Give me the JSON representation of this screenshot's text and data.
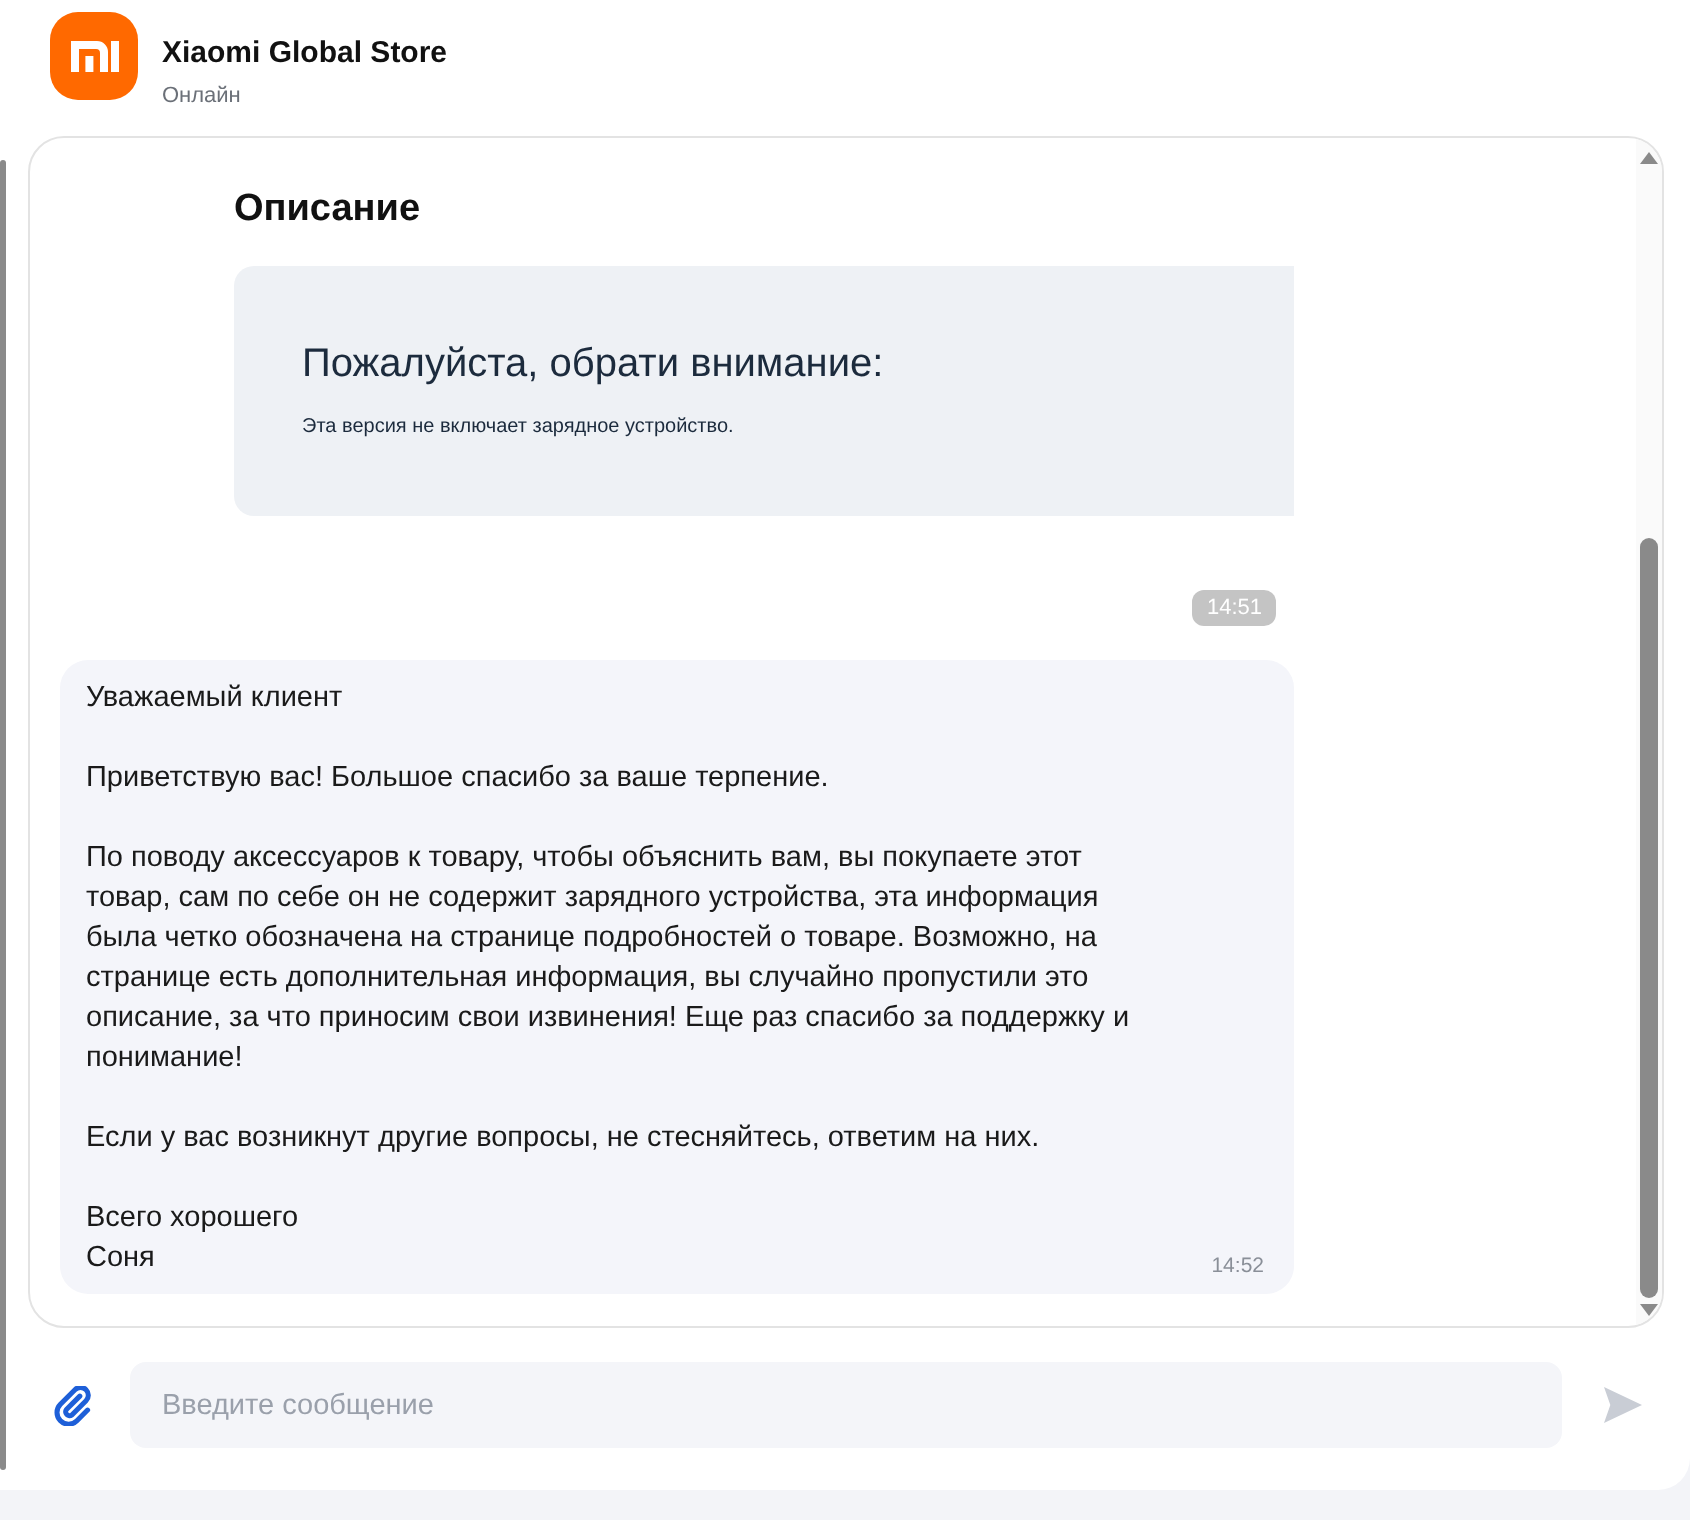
{
  "header": {
    "store_name": "Xiaomi Global Store",
    "status": "Онлайн"
  },
  "messages": [
    {
      "kind": "card",
      "heading": "Описание",
      "notice_title": "Пожалуйста, обрати внимание:",
      "notice_text": "Эта версия не включает зарядное устройство.",
      "time": "14:51"
    },
    {
      "kind": "text",
      "paragraphs": [
        "Уважаемый клиент",
        "Приветствую вас! Большое спасибо за ваше терпение.",
        "По поводу аксессуаров к товару, чтобы объяснить вам, вы покупаете этот товар, сам по себе он не содержит зарядного устройства, эта информация была четко обозначена на странице подробностей о товаре. Возможно, на странице есть дополнительная информация, вы случайно пропустили это описание, за что приносим свои извинения! Еще раз спасибо за поддержку и понимание!",
        "Если у вас возникнут другие вопросы, не стесняйтесь, ответим на них.",
        "Всего хорошего\nСоня"
      ],
      "time": "14:52"
    }
  ],
  "composer": {
    "placeholder": "Введите сообщение"
  }
}
